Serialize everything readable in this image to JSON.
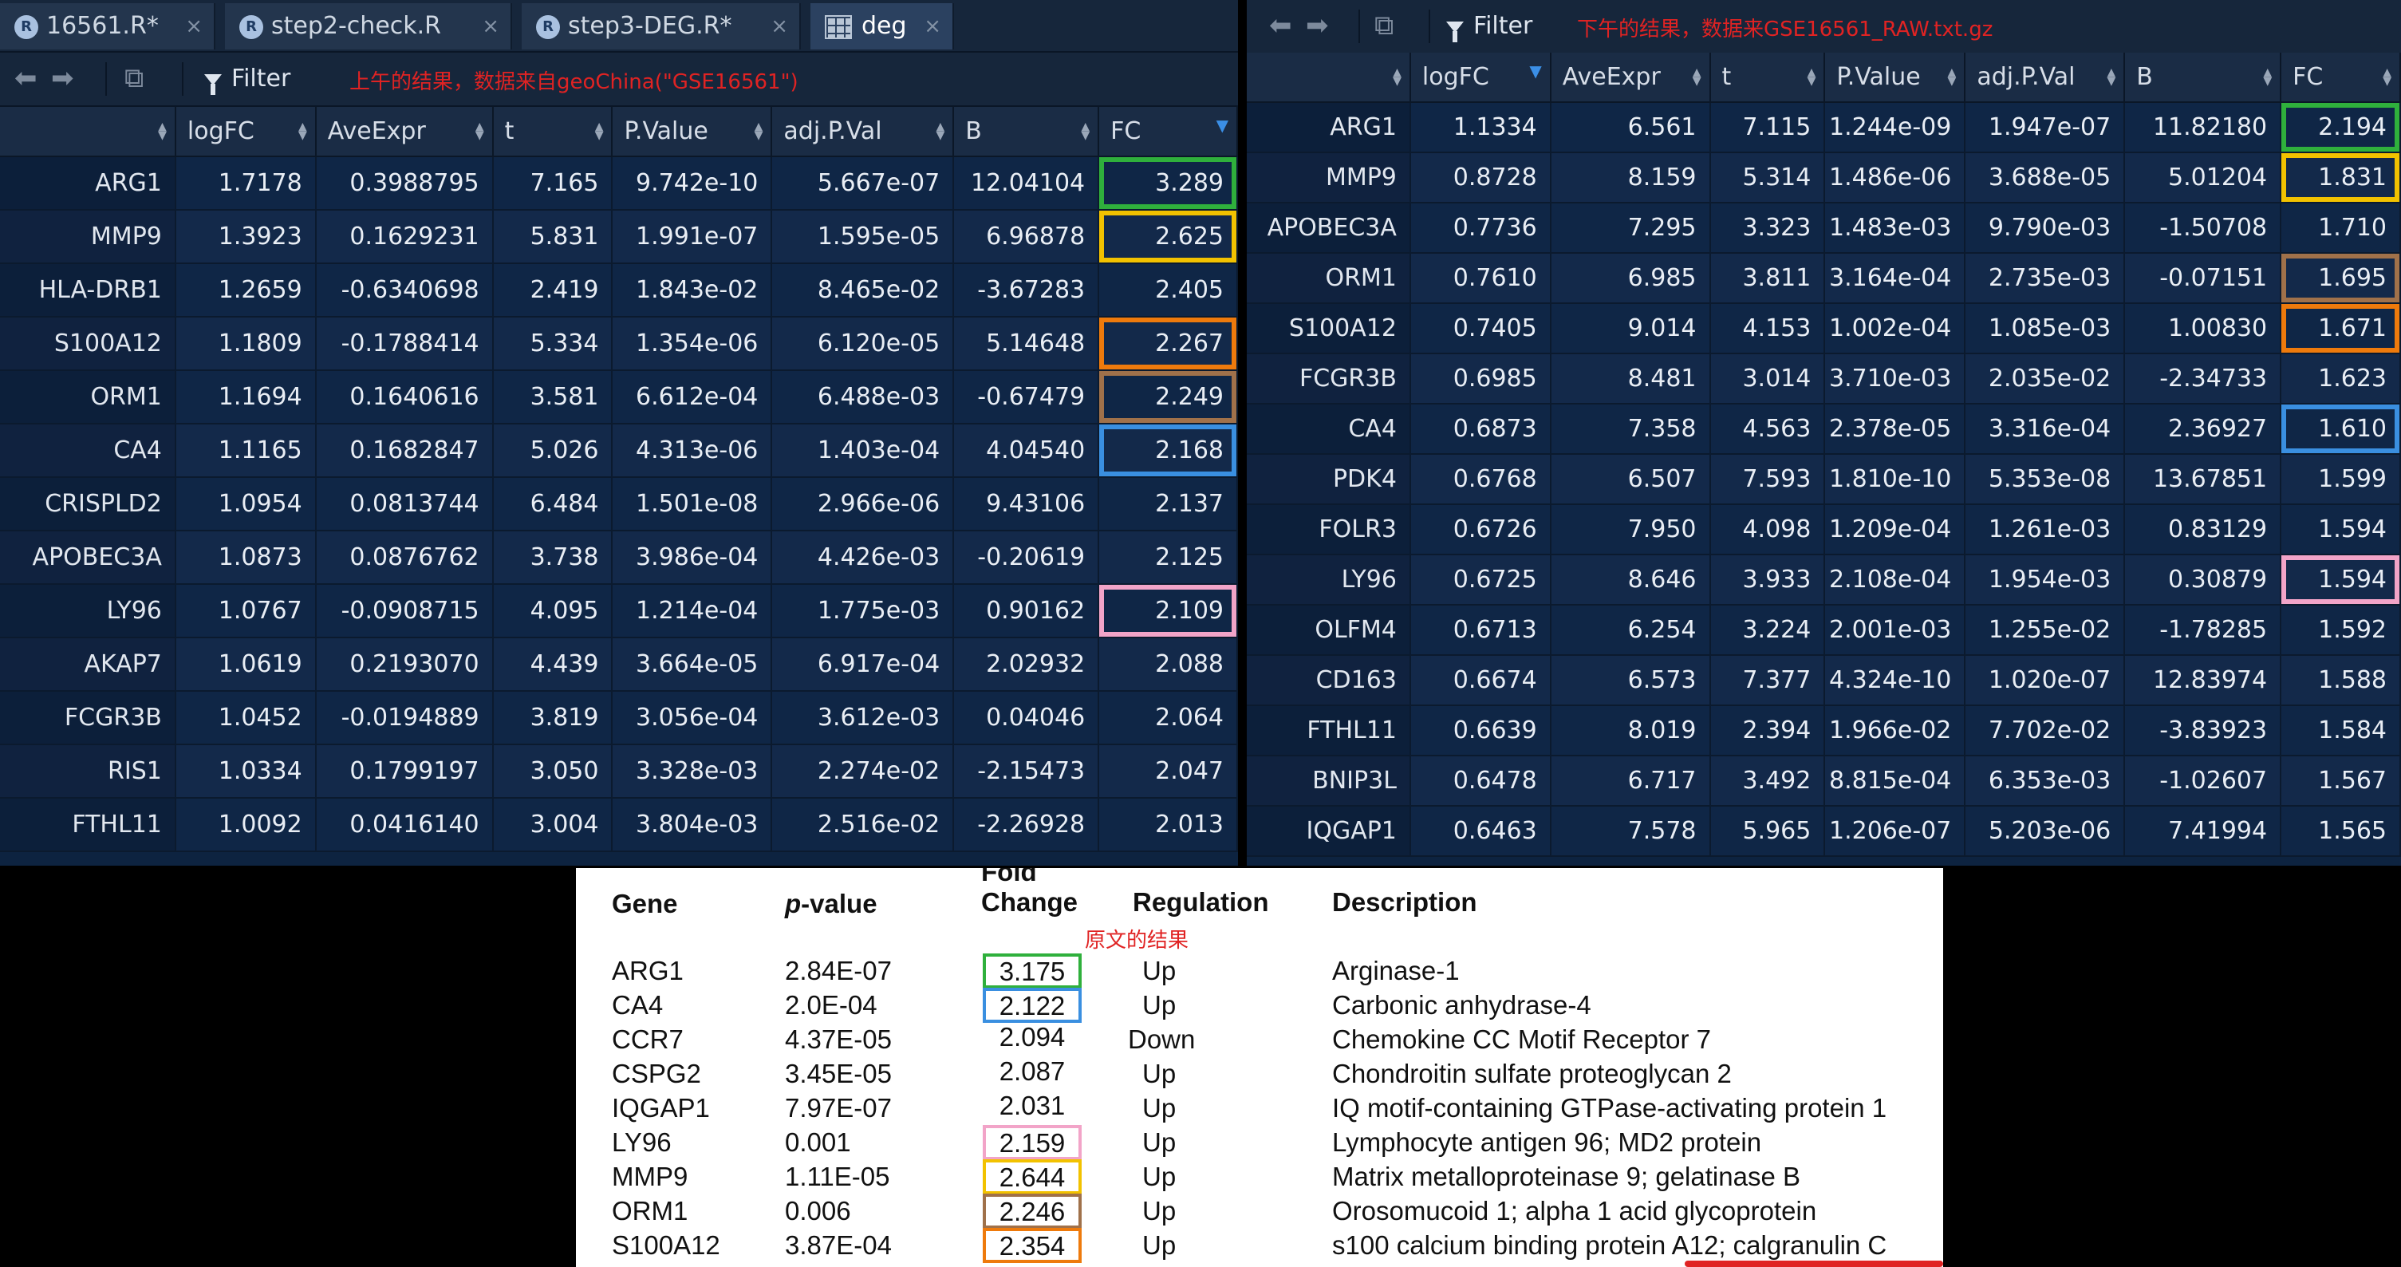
{
  "left_panel": {
    "tabs": [
      {
        "label": "16561.R*",
        "icon": "r-file-icon"
      },
      {
        "label": "step2-check.R",
        "icon": "r-file-icon"
      },
      {
        "label": "step3-DEG.R*",
        "icon": "r-file-icon"
      },
      {
        "label": "deg",
        "icon": "data-grid-icon",
        "active": true
      }
    ],
    "toolbar": {
      "filter_label": "Filter",
      "annotation": "上午的结果，数据来自geoChina(\"GSE16561\")"
    },
    "columns": [
      "",
      "logFC",
      "AveExpr",
      "t",
      "P.Value",
      "adj.P.Val",
      "B",
      "FC"
    ],
    "sorted_column": "FC",
    "rows": [
      [
        "ARG1",
        "1.7178",
        "0.3988795",
        "7.165",
        "9.742e-10",
        "5.667e-07",
        "12.04104",
        "3.289"
      ],
      [
        "MMP9",
        "1.3923",
        "0.1629231",
        "5.831",
        "1.991e-07",
        "1.595e-05",
        "6.96878",
        "2.625"
      ],
      [
        "HLA-DRB1",
        "1.2659",
        "-0.6340698",
        "2.419",
        "1.843e-02",
        "8.465e-02",
        "-3.67283",
        "2.405"
      ],
      [
        "S100A12",
        "1.1809",
        "-0.1788414",
        "5.334",
        "1.354e-06",
        "6.120e-05",
        "5.14648",
        "2.267"
      ],
      [
        "ORM1",
        "1.1694",
        "0.1640616",
        "3.581",
        "6.612e-04",
        "6.488e-03",
        "-0.67479",
        "2.249"
      ],
      [
        "CA4",
        "1.1165",
        "0.1682847",
        "5.026",
        "4.313e-06",
        "1.403e-04",
        "4.04540",
        "2.168"
      ],
      [
        "CRISPLD2",
        "1.0954",
        "0.0813744",
        "6.484",
        "1.501e-08",
        "2.966e-06",
        "9.43106",
        "2.137"
      ],
      [
        "APOBEC3A",
        "1.0873",
        "0.0876762",
        "3.738",
        "3.986e-04",
        "4.426e-03",
        "-0.20619",
        "2.125"
      ],
      [
        "LY96",
        "1.0767",
        "-0.0908715",
        "4.095",
        "1.214e-04",
        "1.775e-03",
        "0.90162",
        "2.109"
      ],
      [
        "AKAP7",
        "1.0619",
        "0.2193070",
        "4.439",
        "3.664e-05",
        "6.917e-04",
        "2.02932",
        "2.088"
      ],
      [
        "FCGR3B",
        "1.0452",
        "-0.0194889",
        "3.819",
        "3.056e-04",
        "3.612e-03",
        "0.04046",
        "2.064"
      ],
      [
        "RIS1",
        "1.0334",
        "0.1799197",
        "3.050",
        "3.328e-03",
        "2.274e-02",
        "-2.15473",
        "2.047"
      ],
      [
        "FTHL11",
        "1.0092",
        "0.0416140",
        "3.004",
        "3.804e-03",
        "2.516e-02",
        "-2.26928",
        "2.013"
      ]
    ],
    "highlight_colors": {
      "ARG1": "#2fb03c",
      "MMP9": "#f2c200",
      "S100A12": "#ee7a0c",
      "ORM1": "#a0714a",
      "CA4": "#3a8fe0",
      "LY96": "#f2a4c8"
    }
  },
  "right_panel": {
    "toolbar": {
      "filter_label": "Filter",
      "annotation": "下午的结果，数据来GSE16561_RAW.txt.gz"
    },
    "columns": [
      "",
      "logFC",
      "AveExpr",
      "t",
      "P.Value",
      "adj.P.Val",
      "B",
      "FC"
    ],
    "sorted_column": "logFC",
    "rows": [
      [
        "ARG1",
        "1.1334",
        "6.561",
        "7.115",
        "1.244e-09",
        "1.947e-07",
        "11.82180",
        "2.194"
      ],
      [
        "MMP9",
        "0.8728",
        "8.159",
        "5.314",
        "1.486e-06",
        "3.688e-05",
        "5.01204",
        "1.831"
      ],
      [
        "APOBEC3A",
        "0.7736",
        "7.295",
        "3.323",
        "1.483e-03",
        "9.790e-03",
        "-1.50708",
        "1.710"
      ],
      [
        "ORM1",
        "0.7610",
        "6.985",
        "3.811",
        "3.164e-04",
        "2.735e-03",
        "-0.07151",
        "1.695"
      ],
      [
        "S100A12",
        "0.7405",
        "9.014",
        "4.153",
        "1.002e-04",
        "1.085e-03",
        "1.00830",
        "1.671"
      ],
      [
        "FCGR3B",
        "0.6985",
        "8.481",
        "3.014",
        "3.710e-03",
        "2.035e-02",
        "-2.34733",
        "1.623"
      ],
      [
        "CA4",
        "0.6873",
        "7.358",
        "4.563",
        "2.378e-05",
        "3.316e-04",
        "2.36927",
        "1.610"
      ],
      [
        "PDK4",
        "0.6768",
        "6.507",
        "7.593",
        "1.810e-10",
        "5.353e-08",
        "13.67851",
        "1.599"
      ],
      [
        "FOLR3",
        "0.6726",
        "7.950",
        "4.098",
        "1.209e-04",
        "1.261e-03",
        "0.83129",
        "1.594"
      ],
      [
        "LY96",
        "0.6725",
        "8.646",
        "3.933",
        "2.108e-04",
        "1.954e-03",
        "0.30879",
        "1.594"
      ],
      [
        "OLFM4",
        "0.6713",
        "6.254",
        "3.224",
        "2.001e-03",
        "1.255e-02",
        "-1.78285",
        "1.592"
      ],
      [
        "CD163",
        "0.6674",
        "6.573",
        "7.377",
        "4.324e-10",
        "1.020e-07",
        "12.83974",
        "1.588"
      ],
      [
        "FTHL11",
        "0.6639",
        "8.019",
        "2.394",
        "1.966e-02",
        "7.702e-02",
        "-3.83923",
        "1.584"
      ],
      [
        "BNIP3L",
        "0.6478",
        "6.717",
        "3.492",
        "8.815e-04",
        "6.353e-03",
        "-1.02607",
        "1.567"
      ],
      [
        "IQGAP1",
        "0.6463",
        "7.578",
        "5.965",
        "1.206e-07",
        "5.203e-06",
        "7.41994",
        "1.565"
      ]
    ],
    "highlight_colors": {
      "ARG1": "#2fb03c",
      "MMP9": "#f2c200",
      "ORM1": "#a0714a",
      "S100A12": "#ee7a0c",
      "CA4": "#3a8fe0",
      "LY96": "#f2a4c8"
    }
  },
  "paper": {
    "headers": {
      "gene": "Gene",
      "pvalue_prefix": "p",
      "pvalue_suffix": "-value",
      "fold_top": "Fold",
      "fold_bottom": "Change",
      "regulation": "Regulation",
      "description": "Description"
    },
    "note": "原文的结果",
    "rows": [
      {
        "gene": "ARG1",
        "p": "2.84E-07",
        "fc": "3.175",
        "reg": "Up",
        "desc": "Arginase-1",
        "box": "#2fb03c"
      },
      {
        "gene": "CA4",
        "p": "2.0E-04",
        "fc": "2.122",
        "reg": "Up",
        "desc": "Carbonic anhydrase-4",
        "box": "#3a8fe0"
      },
      {
        "gene": "CCR7",
        "p": "4.37E-05",
        "fc": "2.094",
        "reg": "Down",
        "desc": "Chemokine CC Motif Receptor 7",
        "box": ""
      },
      {
        "gene": "CSPG2",
        "p": "3.45E-05",
        "fc": "2.087",
        "reg": "Up",
        "desc": "Chondroitin sulfate proteoglycan 2",
        "box": ""
      },
      {
        "gene": "IQGAP1",
        "p": "7.97E-07",
        "fc": "2.031",
        "reg": "Up",
        "desc": "IQ motif-containing GTPase-activating protein 1",
        "box": ""
      },
      {
        "gene": "LY96",
        "p": "0.001",
        "fc": "2.159",
        "reg": "Up",
        "desc": "Lymphocyte antigen 96; MD2 protein",
        "box": "#f2a4c8"
      },
      {
        "gene": "MMP9",
        "p": "1.11E-05",
        "fc": "2.644",
        "reg": "Up",
        "desc": "Matrix metalloproteinase 9; gelatinase B",
        "box": "#f2c200"
      },
      {
        "gene": "ORM1",
        "p": "0.006",
        "fc": "2.246",
        "reg": "Up",
        "desc": "Orosomucoid 1; alpha 1 acid glycoprotein",
        "box": "#a0714a"
      },
      {
        "gene": "S100A12",
        "p": "3.87E-04",
        "fc": "2.354",
        "reg": "Up",
        "desc": "s100 calcium binding protein A12; calgranulin C",
        "box": "#ee7a0c"
      }
    ]
  }
}
